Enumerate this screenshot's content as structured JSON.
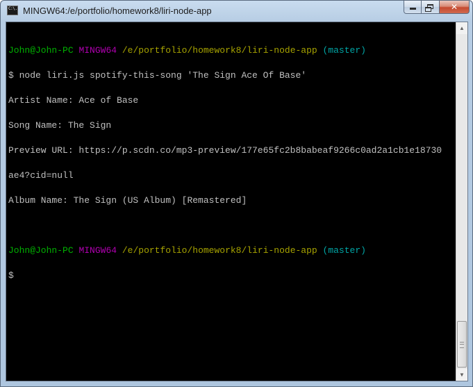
{
  "window": {
    "title": "MINGW64:/e/portfolio/homework8/liri-node-app",
    "icon": "cmd-icon",
    "icon_text": "C:\\."
  },
  "caption_buttons": {
    "minimize": "minimize-icon",
    "maximize": "restore-icon",
    "close_label": "✕"
  },
  "colors": {
    "user_host": "#00b000",
    "shell": "#b000b0",
    "path": "#a7a300",
    "branch": "#00a6a6",
    "output": "#c0c0c0",
    "background": "#000000"
  },
  "terminal": {
    "prompt1": {
      "user": "John@John-PC",
      "shell": "MINGW64",
      "path": "/e/portfolio/homework8/liri-node-app",
      "branch": "(master)"
    },
    "command": "$ node liri.js spotify-this-song 'The Sign Ace Of Base'",
    "output": [
      "Artist Name: Ace of Base",
      "Song Name: The Sign",
      "Preview URL: https://p.scdn.co/mp3-preview/177e65fc2b8babeaf9266c0ad2a1cb1e18730",
      "ae4?cid=null",
      "Album Name: The Sign (US Album) [Remastered]"
    ],
    "prompt2": {
      "user": "John@John-PC",
      "shell": "MINGW64",
      "path": "/e/portfolio/homework8/liri-node-app",
      "branch": "(master)"
    },
    "cursor_line": "$"
  },
  "scrollbar": {
    "up_arrow": "▲",
    "down_arrow": "▼",
    "position": 1.0
  }
}
